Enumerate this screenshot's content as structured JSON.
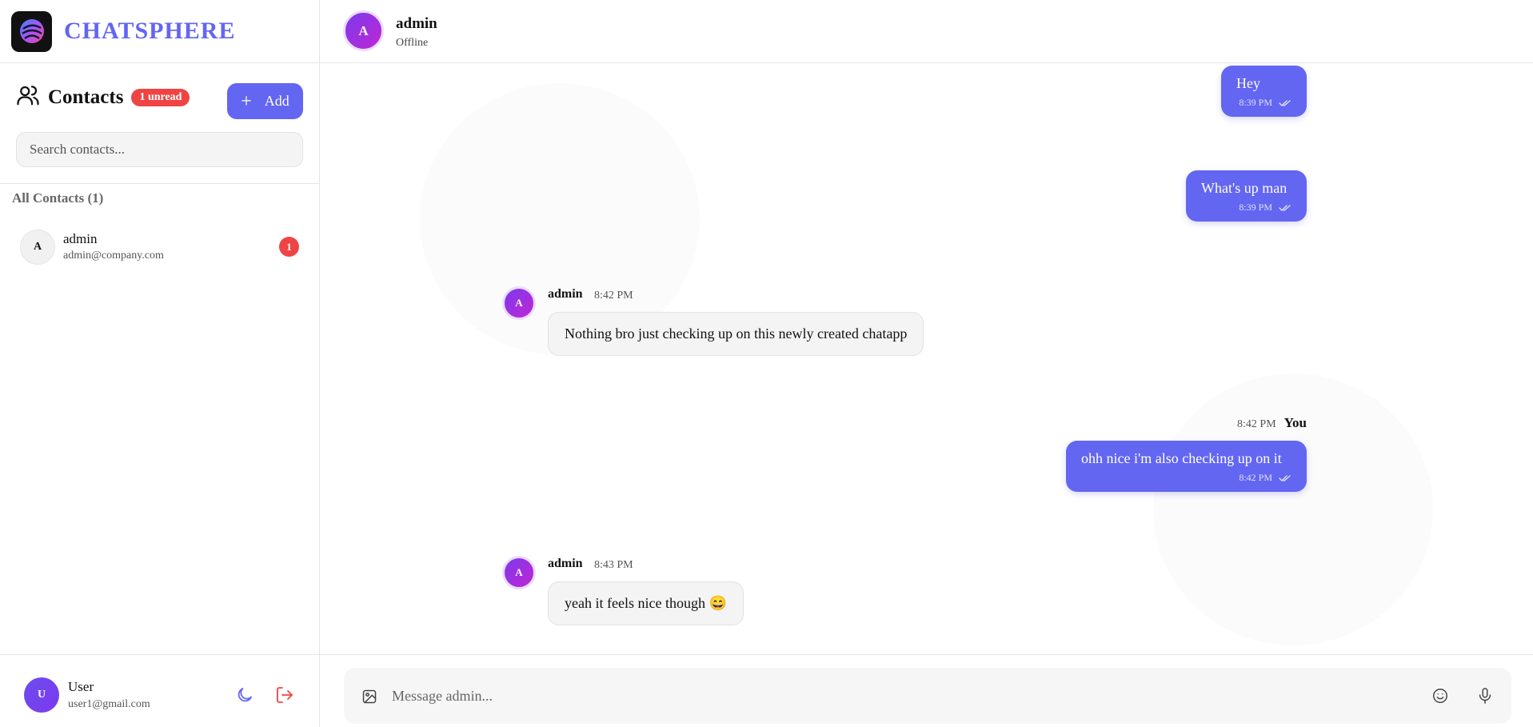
{
  "brand": {
    "name": "CHATSPHERE",
    "accent": "#6366f1"
  },
  "contacts_panel": {
    "title": "Contacts",
    "unread_badge": "1 unread",
    "add_label": "Add",
    "search_placeholder": "Search contacts...",
    "section_label": "All Contacts (1)",
    "items": [
      {
        "initial": "A",
        "name": "admin",
        "email": "admin@company.com",
        "unread_count": "1"
      }
    ]
  },
  "current_user": {
    "initial": "U",
    "name": "User",
    "email": "user1@gmail.com"
  },
  "chat_header": {
    "initial": "A",
    "name": "admin",
    "status": "Offline"
  },
  "messages": [
    {
      "direction": "out",
      "text": "Hey",
      "time": "8:39 PM",
      "read_icon": "double-check-icon"
    },
    {
      "direction": "out",
      "text": "What's up man",
      "time": "8:39 PM",
      "read_icon": "double-check-icon"
    },
    {
      "direction": "in",
      "initial": "A",
      "sender": "admin",
      "time": "8:42 PM",
      "text": "Nothing bro just checking up on this newly created chatapp"
    },
    {
      "direction": "out",
      "sender": "You",
      "header_time": "8:42 PM",
      "text": "ohh nice i'm also checking up on it",
      "time": "8:42 PM",
      "read_icon": "double-check-icon"
    },
    {
      "direction": "in",
      "initial": "A",
      "sender": "admin",
      "time": "8:43 PM",
      "text": "yeah it feels nice though 😄"
    }
  ],
  "composer": {
    "placeholder": "Message admin..."
  },
  "colors": {
    "accent": "#6366f1",
    "danger": "#ef4444",
    "avatar_gradient_start": "#7c3aed",
    "avatar_gradient_end": "#c026d3"
  },
  "icons": [
    "app-logo-icon",
    "users-icon",
    "plus-icon",
    "moon-icon",
    "logout-icon",
    "double-check-icon",
    "image-icon",
    "emoji-icon",
    "microphone-icon"
  ]
}
